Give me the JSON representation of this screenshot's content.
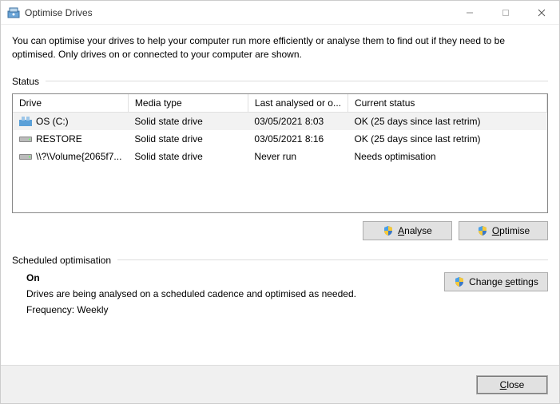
{
  "window": {
    "title": "Optimise Drives"
  },
  "description": "You can optimise your drives to help your computer run more efficiently or analyse them to find out if they need to be optimised. Only drives on or connected to your computer are shown.",
  "status": {
    "label": "Status",
    "columns": {
      "drive": "Drive",
      "media": "Media type",
      "last": "Last analysed or o...",
      "current": "Current status"
    },
    "rows": [
      {
        "drive": "OS (C:)",
        "icon": "os",
        "media": "Solid state drive",
        "last": "03/05/2021 8:03",
        "current": "OK (25 days since last retrim)"
      },
      {
        "drive": "RESTORE",
        "icon": "hdd",
        "media": "Solid state drive",
        "last": "03/05/2021 8:16",
        "current": "OK (25 days since last retrim)"
      },
      {
        "drive": "\\\\?\\Volume{2065f7...",
        "icon": "hdd",
        "media": "Solid state drive",
        "last": "Never run",
        "current": "Needs optimisation"
      }
    ]
  },
  "buttons": {
    "analyse": "Analyse",
    "optimise": "Optimise",
    "change_settings": "Change settings",
    "close": "Close"
  },
  "scheduled": {
    "label": "Scheduled optimisation",
    "on": "On",
    "line1": "Drives are being analysed on a scheduled cadence and optimised as needed.",
    "line2": "Frequency: Weekly"
  }
}
